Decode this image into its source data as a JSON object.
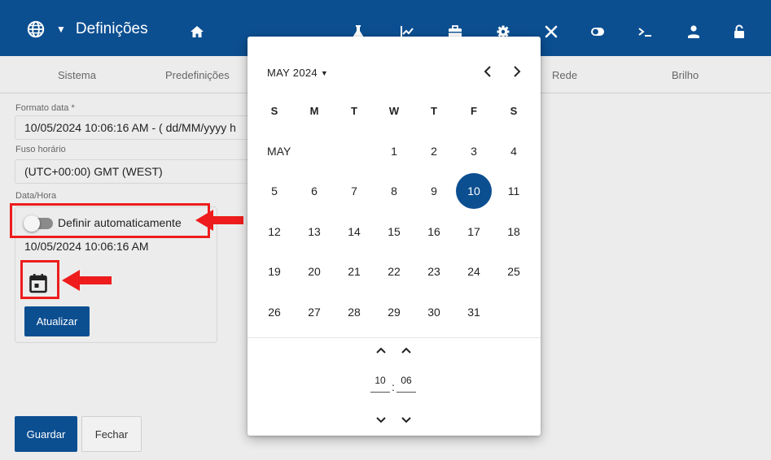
{
  "header": {
    "title": "Definições",
    "icons": [
      "home-icon",
      "flask-icon",
      "chart-icon",
      "briefcase-icon",
      "gear-icon",
      "tools-icon",
      "toggle-icon",
      "terminal-icon",
      "user-icon",
      "lock-icon"
    ],
    "bg": "#0c4f91"
  },
  "tabs": [
    "Sistema",
    "Predefinições",
    "Rede",
    "Brilho"
  ],
  "form": {
    "date_format_label": "Formato data *",
    "date_format_value": "10/05/2024 10:06:16 AM - ( dd/MM/yyyy h",
    "timezone_label": "Fuso horário",
    "timezone_value": "(UTC+00:00) GMT (WEST)",
    "datetime_label": "Data/Hora",
    "auto_set_label": "Definir automaticamente",
    "auto_set_on": false,
    "current_datetime": "10/05/2024 10:06:16 AM",
    "update_button": "Atualizar",
    "save_button": "Guardar",
    "close_button": "Fechar"
  },
  "datepicker": {
    "month_year": "MAY 2024",
    "month_label": "MAY",
    "weekdays": [
      "S",
      "M",
      "T",
      "W",
      "T",
      "F",
      "S"
    ],
    "weeks": [
      [
        "",
        "",
        "",
        "1",
        "2",
        "3",
        "4"
      ],
      [
        "5",
        "6",
        "7",
        "8",
        "9",
        "10",
        "11"
      ],
      [
        "12",
        "13",
        "14",
        "15",
        "16",
        "17",
        "18"
      ],
      [
        "19",
        "20",
        "21",
        "22",
        "23",
        "24",
        "25"
      ],
      [
        "26",
        "27",
        "28",
        "29",
        "30",
        "31",
        ""
      ]
    ],
    "selected_day": "10",
    "hour": "10",
    "minute": "06",
    "time_separator": ":"
  },
  "colors": {
    "primary": "#0c4f91",
    "highlight": "#ee1c1c"
  }
}
